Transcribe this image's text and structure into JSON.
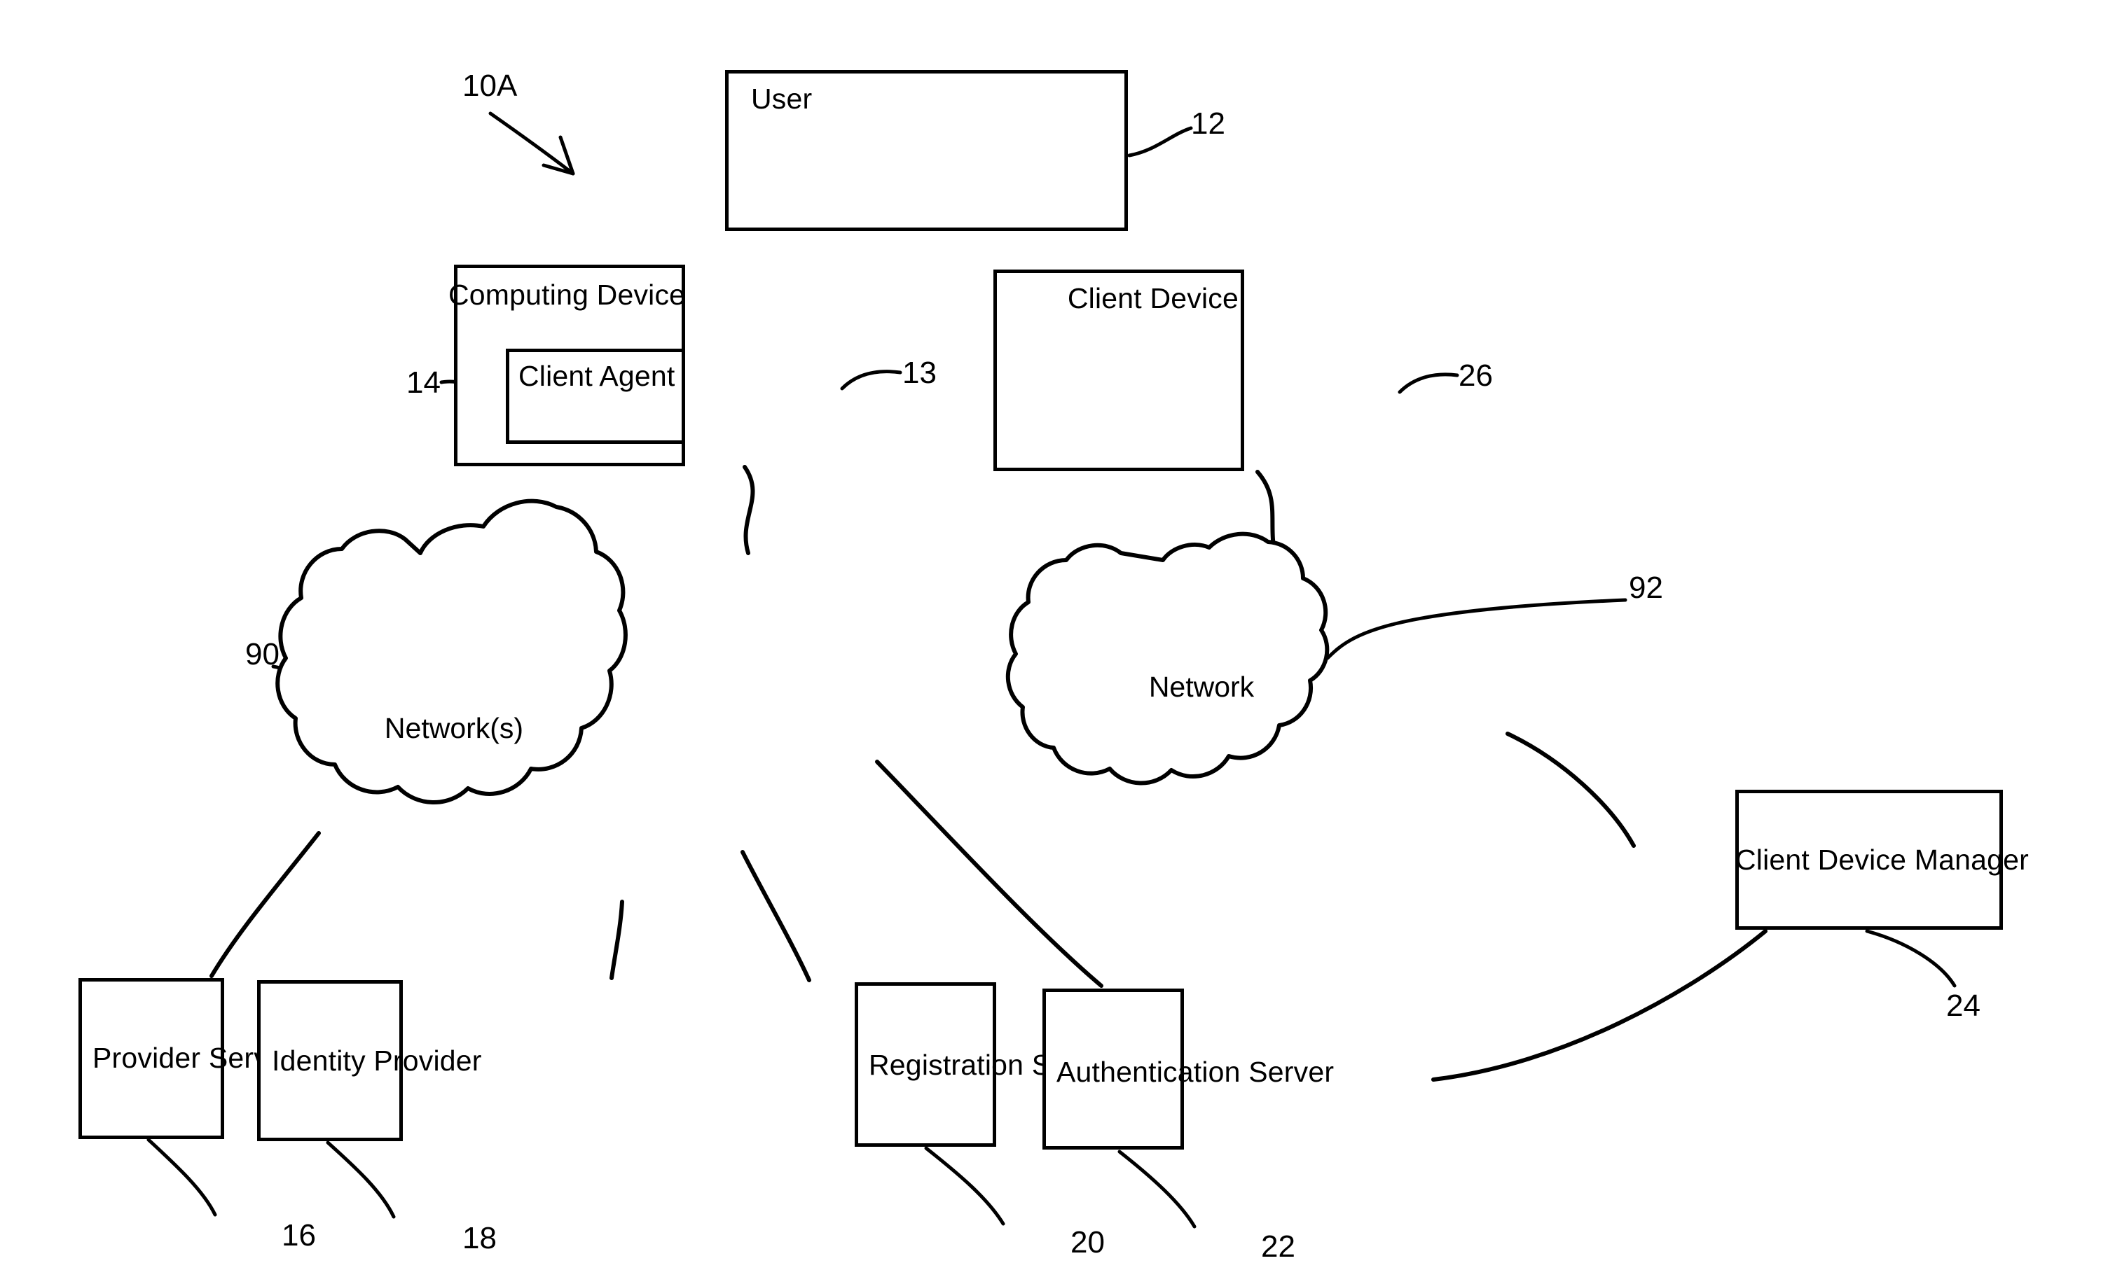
{
  "figure": {
    "figure_tag": "10A",
    "nodes": [
      {
        "id": "user",
        "label": "User",
        "ref": "12"
      },
      {
        "id": "computing_device",
        "label": "Computing Device",
        "ref": "13"
      },
      {
        "id": "client_agent",
        "label": "Client Agent",
        "ref": "14"
      },
      {
        "id": "client_device",
        "label": "Client Device",
        "ref": "26"
      },
      {
        "id": "networks_cloud",
        "label": "Network(s)",
        "ref": "90"
      },
      {
        "id": "network_cloud",
        "label": "Network",
        "ref": "92"
      },
      {
        "id": "client_device_manager",
        "label": "Client Device Manager",
        "ref": "24"
      },
      {
        "id": "provider_server",
        "label": "Provider Server",
        "ref": "16"
      },
      {
        "id": "identity_provider",
        "label": "Identity Provider",
        "ref": "18"
      },
      {
        "id": "registration_server",
        "label": "Registration Server",
        "ref": "20"
      },
      {
        "id": "authentication_server",
        "label": "Authentication Server",
        "ref": "22"
      }
    ],
    "colors": {
      "line": "#000000",
      "background": "#ffffff"
    }
  }
}
